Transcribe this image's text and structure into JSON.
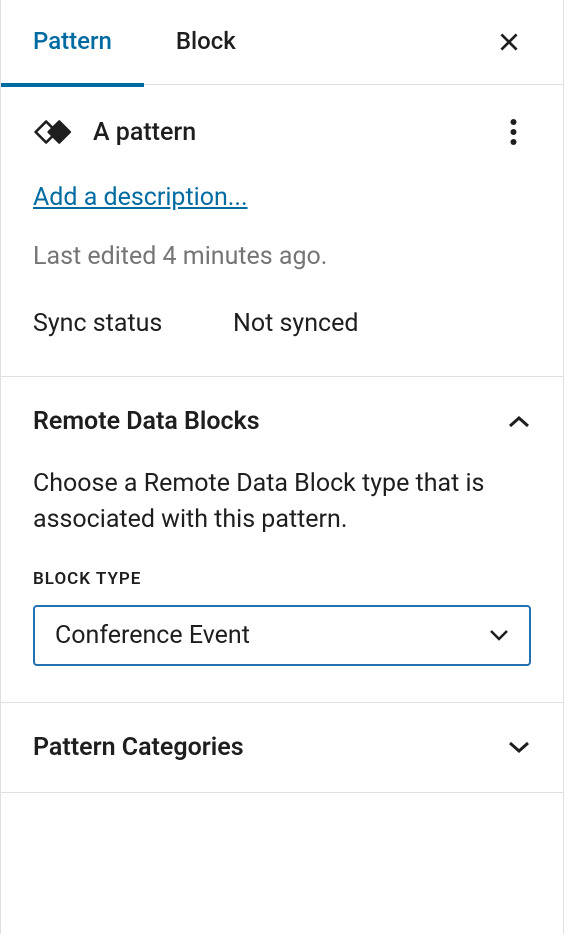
{
  "tabs": {
    "pattern": "Pattern",
    "block": "Block"
  },
  "pattern": {
    "title": "A pattern",
    "add_description": "Add a description...",
    "last_edited": "Last edited 4 minutes ago.",
    "sync_label": "Sync status",
    "sync_value": "Not synced"
  },
  "sections": {
    "remote_data_blocks": {
      "title": "Remote Data Blocks",
      "description": "Choose a Remote Data Block type that is associated with this pattern.",
      "field_label": "BLOCK TYPE",
      "selected": "Conference Event"
    },
    "pattern_categories": {
      "title": "Pattern Categories"
    }
  }
}
